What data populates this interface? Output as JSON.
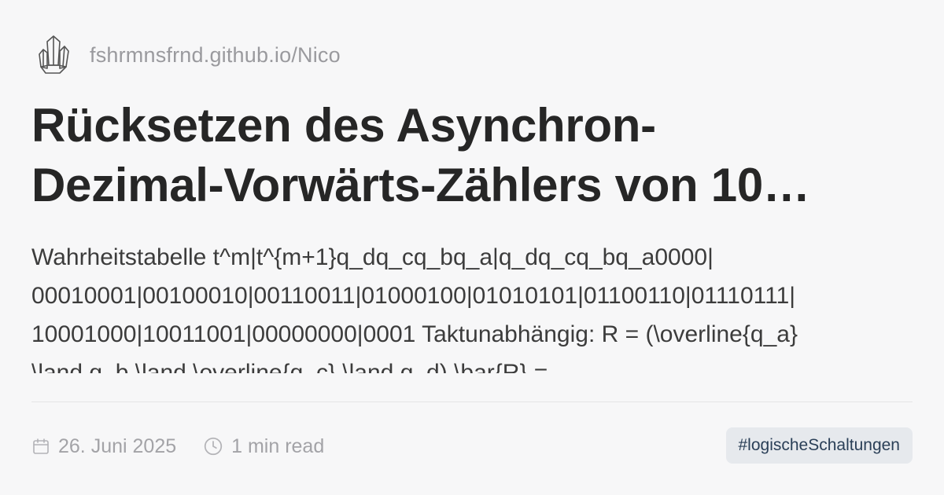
{
  "site": {
    "logo_icon": "crystal-logo-icon",
    "url": "fshrmnsfrnd.github.io/Nico"
  },
  "post": {
    "title_lines": [
      "Rücksetzen des Asynchron-",
      "Dezimal-Vorwärts-Zählers von 10…"
    ],
    "excerpt_lines": [
      "Wahrheitstabelle t^m|t^{m+1}q_dq_cq_bq_a|q_dq_cq_bq_a0000|",
      "00010001|00100010|00110011|01000100|01010101|01100110|01110111|",
      "10001000|10011001|00000000|0001 Taktunabhängig:      R = (\\overline{q_a}",
      "\\land q_b \\land \\overline{q_c} \\land q_d)      \\bar{R} ="
    ]
  },
  "meta": {
    "date_icon": "calendar-icon",
    "date": "26. Juni 2025",
    "read_icon": "clock-icon",
    "read_time": "1 min read"
  },
  "tag": "#logischeSchaltungen",
  "colors": {
    "background": "#f7f7f8",
    "title": "#262626",
    "muted": "#a3a3a7",
    "tag_bg": "#e6e9ed",
    "tag_text": "#2a3f57"
  }
}
